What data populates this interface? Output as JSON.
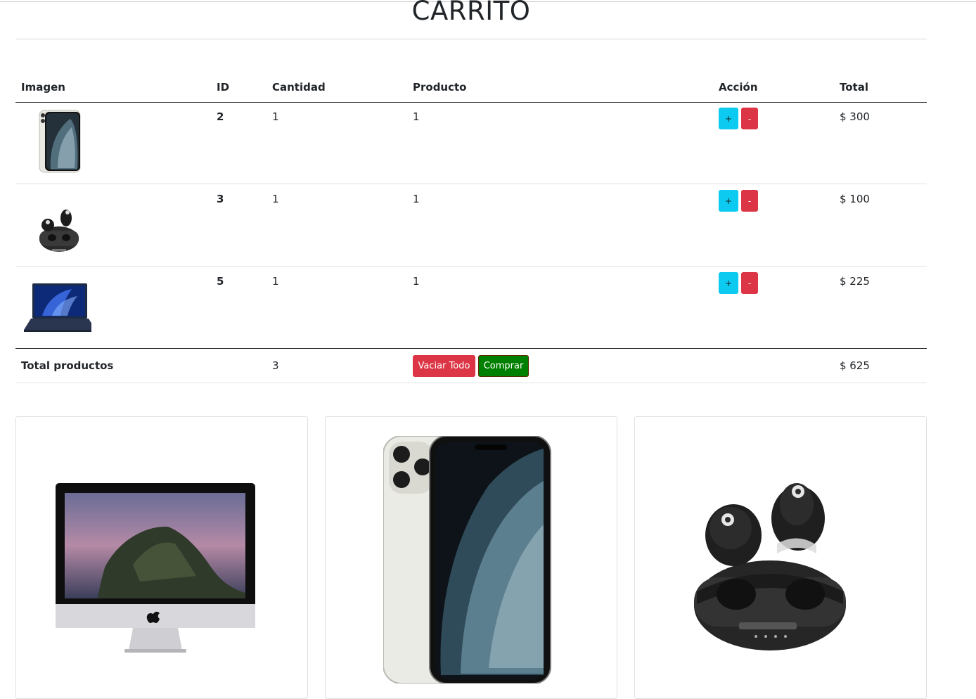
{
  "page": {
    "title": "CARRITO"
  },
  "cart": {
    "headers": [
      "Imagen",
      "ID",
      "Cantidad",
      "Producto",
      "Acción",
      "Total"
    ],
    "rows": [
      {
        "image": "iphone-image",
        "id": "2",
        "cantidad": "1",
        "producto": "1",
        "plus_label": "+",
        "minus_label": "-",
        "total": "$ 300"
      },
      {
        "image": "earbuds-image",
        "id": "3",
        "cantidad": "1",
        "producto": "1",
        "plus_label": "+",
        "minus_label": "-",
        "total": "$ 100"
      },
      {
        "image": "laptop-image",
        "id": "5",
        "cantidad": "1",
        "producto": "1",
        "plus_label": "+",
        "minus_label": "-",
        "total": "$ 225"
      }
    ],
    "footer": {
      "label": "Total productos",
      "count": "3",
      "empty_label": "Vaciar Todo",
      "buy_label": "Comprar",
      "total": "$ 625"
    }
  },
  "products": [
    {
      "image": "imac-image"
    },
    {
      "image": "iphone-image"
    },
    {
      "image": "earbuds-image"
    }
  ],
  "colors": {
    "plus_button": "#0dcaf0",
    "minus_button": "#dc3545",
    "empty_button": "#dc3545",
    "buy_button": "#008000"
  }
}
